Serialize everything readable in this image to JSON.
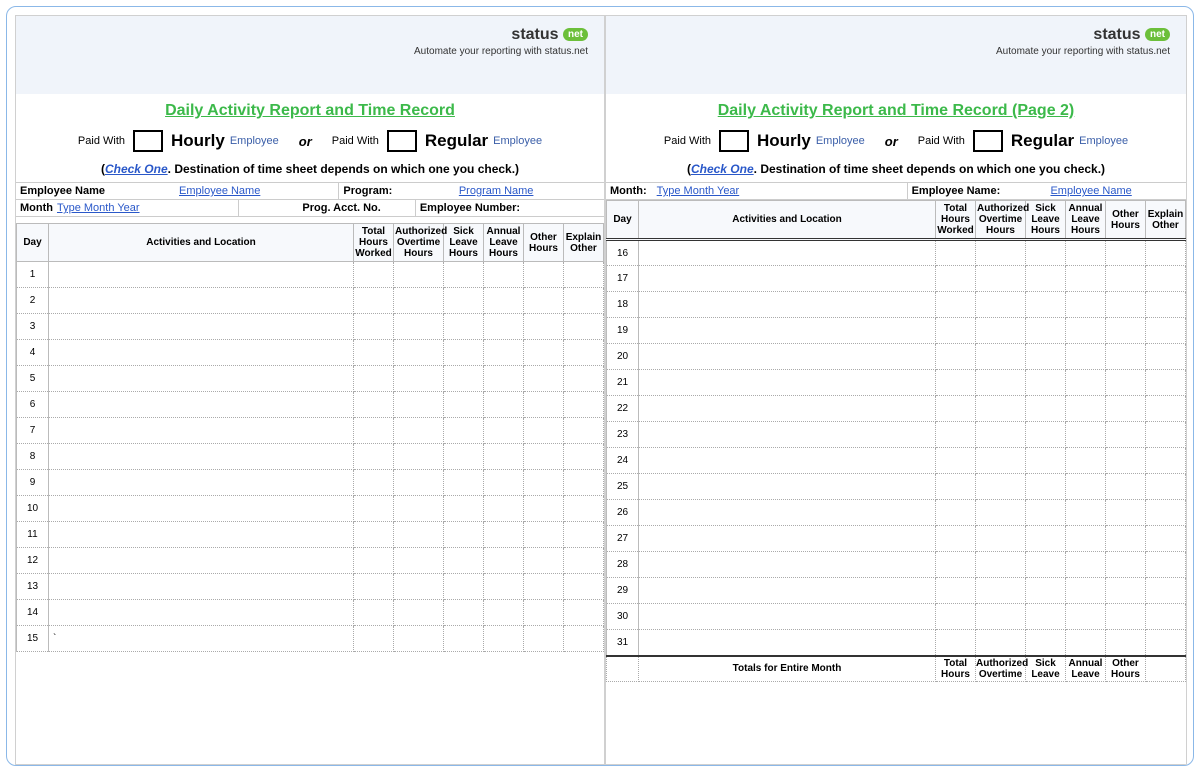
{
  "brand": {
    "name": "status",
    "badge": "net",
    "tagline": "Automate your reporting with status.net"
  },
  "page1": {
    "title": "Daily Activity Report and Time Record",
    "paidWith": "Paid With",
    "hourly": "Hourly",
    "regular": "Regular",
    "employee": "Employee",
    "or": "or",
    "checkOneLabel": "Check One",
    "checkOneText": ".   Destination of time sheet depends on which one you check.)",
    "empNameLabel": "Employee Name",
    "empNameVal": "Employee Name",
    "programLabel": "Program:",
    "programVal": "Program Name",
    "monthLabel": "Month",
    "monthVal": "Type Month Year",
    "acctLabel": "Prog. Acct. No.",
    "empNumLabel": "Employee Number:",
    "cols": {
      "day": "Day",
      "activities": "Activities and Location",
      "total": "Total Hours Worked",
      "auth": "Authorized Overtime Hours",
      "sick": "Sick Leave Hours",
      "annual": "Annual Leave Hours",
      "other": "Other Hours",
      "explain": "Explain Other"
    },
    "days": [
      "1",
      "2",
      "3",
      "4",
      "5",
      "6",
      "7",
      "8",
      "9",
      "10",
      "11",
      "12",
      "13",
      "14",
      "15"
    ],
    "row15note": "`"
  },
  "page2": {
    "title": "Daily Activity Report and Time Record (Page 2)",
    "monthLabel": "Month:",
    "monthVal": "Type Month Year",
    "empNameLabel": "Employee Name:",
    "empNameVal": "Employee Name",
    "days": [
      "16",
      "17",
      "18",
      "19",
      "20",
      "21",
      "22",
      "23",
      "24",
      "25",
      "26",
      "27",
      "28",
      "29",
      "30",
      "31"
    ],
    "totalsLabel": "Totals for Entire Month",
    "totCols": {
      "total": "Total Hours",
      "auth": "Authorized Overtime",
      "sick": "Sick Leave",
      "annual": "Annual Leave",
      "other": "Other Hours"
    }
  }
}
